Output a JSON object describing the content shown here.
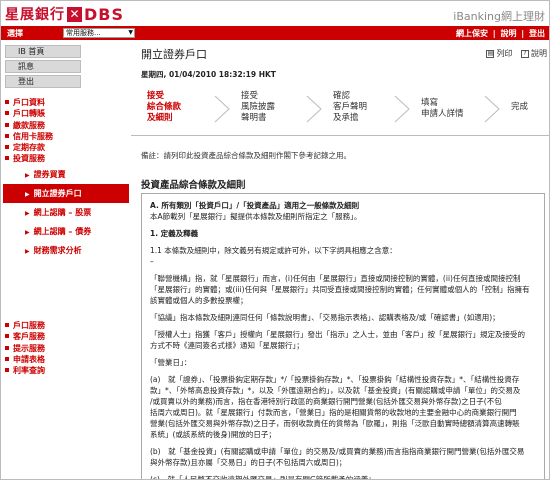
{
  "header": {
    "logo_cn": "星展銀行",
    "logo_x": "✕",
    "logo_brand": "DBS",
    "title": "iBanking網上理財"
  },
  "topbar": {
    "select_label": "選擇",
    "select_value": "常用服務...",
    "links": [
      "網上保安",
      "|",
      "說明",
      "|",
      "登出"
    ]
  },
  "sidebar": {
    "ib_items": [
      "IB 首頁",
      "訊息",
      "登出"
    ],
    "nav1": [
      {
        "label": "戶口資料",
        "type": "main"
      },
      {
        "label": "戶口轉賬",
        "type": "main"
      },
      {
        "label": "繳款服務",
        "type": "main"
      },
      {
        "label": "信用卡服務",
        "type": "main"
      },
      {
        "label": "定期存款",
        "type": "main"
      },
      {
        "label": "投資服務",
        "type": "main"
      },
      {
        "label": "證券買賣",
        "type": "sub"
      },
      {
        "label": "開立證券戶口",
        "type": "sub-active"
      },
      {
        "label": "網上認購 – 股票",
        "type": "sub"
      },
      {
        "label": "網上認購 – 債券",
        "type": "sub"
      },
      {
        "label": "財務需求分析",
        "type": "sub"
      }
    ],
    "nav2": [
      "戶口服務",
      "客戶服務",
      "提示服務",
      "申請表格",
      "利率查詢"
    ]
  },
  "main": {
    "title": "開立證券戶口",
    "toolbar": {
      "print": "列印",
      "help": "說明"
    },
    "timestamp": "星期四, 01/04/2010 18:32:19 HKT",
    "steps": [
      [
        "接受",
        "綜合條款",
        "及細則"
      ],
      [
        "接受",
        "風險披露",
        "聲明書"
      ],
      [
        "確認",
        "客戶聲明",
        "及承擔"
      ],
      [
        "填寫",
        "申請人詳情"
      ],
      [
        "完成"
      ]
    ],
    "remark": "備註：請列印此投資產品綜合條款及細則作閣下參考記錄之用。",
    "section_title": "投資產品綜合條款及細則",
    "terms": [
      {
        "t": "A. 所有類別「投資戶口」/「投資產品」適用之一般條款及細則",
        "b": true
      },
      {
        "t": "本A節載列「星展銀行」擬提供本條款及細則所指定之「服務」。",
        "b": false
      },
      {
        "t": "",
        "gap": true
      },
      {
        "t": "1. 定義及釋義",
        "b": true
      },
      {
        "t": "",
        "gap": true
      },
      {
        "t": "1.1 本條款及細則中，除文義另有規定或許可外，以下字詞具相應之含意：",
        "b": false
      },
      {
        "t": "–",
        "b": false
      },
      {
        "t": "",
        "gap": true
      },
      {
        "t": "「聯營機構」指，就「星展銀行」而言，(i)任何由「星展銀行」直接或間接控制的實體，(ii)任何直接或間接控制",
        "b": false
      },
      {
        "t": "「星展銀行」的實體；或(iii)任何與「星展銀行」共同受直接或間接控制的實體；任何實體或個人的「控制」指擁有",
        "b": false
      },
      {
        "t": "該實體或個人的多數投票權；",
        "b": false
      },
      {
        "t": "",
        "gap": true
      },
      {
        "t": "「協議」指本條款及細則連同任何「條款說明書」、「交易指示表格」、認購表格及/或「確認書」(如適用)；",
        "b": false
      },
      {
        "t": "",
        "gap": true
      },
      {
        "t": "「授權人士」指獲「客戶」授權向「星展銀行」發出「指示」之人士，並由「客戶」按「星展銀行」規定及接受的",
        "b": false
      },
      {
        "t": "方式不時《連同簽名式樣》通知「星展銀行」；",
        "b": false
      },
      {
        "t": "",
        "gap": true
      },
      {
        "t": "「營業日」：",
        "b": false
      },
      {
        "t": "",
        "gap": true
      },
      {
        "t": "(a)　就「證券」、「投票掛鈎定期存款」*/「投票掛鈎存款」*、「投票掛鈎「結構性投資存款」*、「結構性投資存",
        "b": false
      },
      {
        "t": "款」*、「外幣高息投資存款」*，以及「外匯遠期合約」，以及就「基金投資」(有關認購或申請「單位」的交易及",
        "b": false
      },
      {
        "t": "/或買賣以外的業務)而言，指在香港特別行政區的商業銀行開門營業(包括外匯交易與外幣存款)之日子(不包",
        "b": false
      },
      {
        "t": "括周六或周日)。就「星展銀行」付款而言，「營業日」指的是相關貨幣的收款地的主要金融中心的商業銀行開門",
        "b": false
      },
      {
        "t": "營業(包括外匯交易與外幣存款)之日子，而例收款責任的貨幣為「歐羅」，則指「泛歐自動實時總額清算高速轉賬",
        "b": false
      },
      {
        "t": "系統」(或該系統的後身)開放的日子；",
        "b": false
      },
      {
        "t": "",
        "gap": true
      },
      {
        "t": "(b)　就「基金投資」(有關認購或申請「單位」的交易及/或買賣的業務)而言指指商業銀行開門營業(包括外匯交易",
        "b": false
      },
      {
        "t": "與外幣存款)且亦屬「交易日」的日子(不包括周六或周日)；",
        "b": false
      },
      {
        "t": "",
        "gap": true
      },
      {
        "t": "(c)　就「人民幣不交收遠期外匯交易」則是有關G節所載予的涵義；",
        "b": false
      }
    ]
  },
  "colors": {
    "brand_red": "#cc0000",
    "nav_red": "#cc0000",
    "ib_box_gray": "#d9d9d9"
  }
}
